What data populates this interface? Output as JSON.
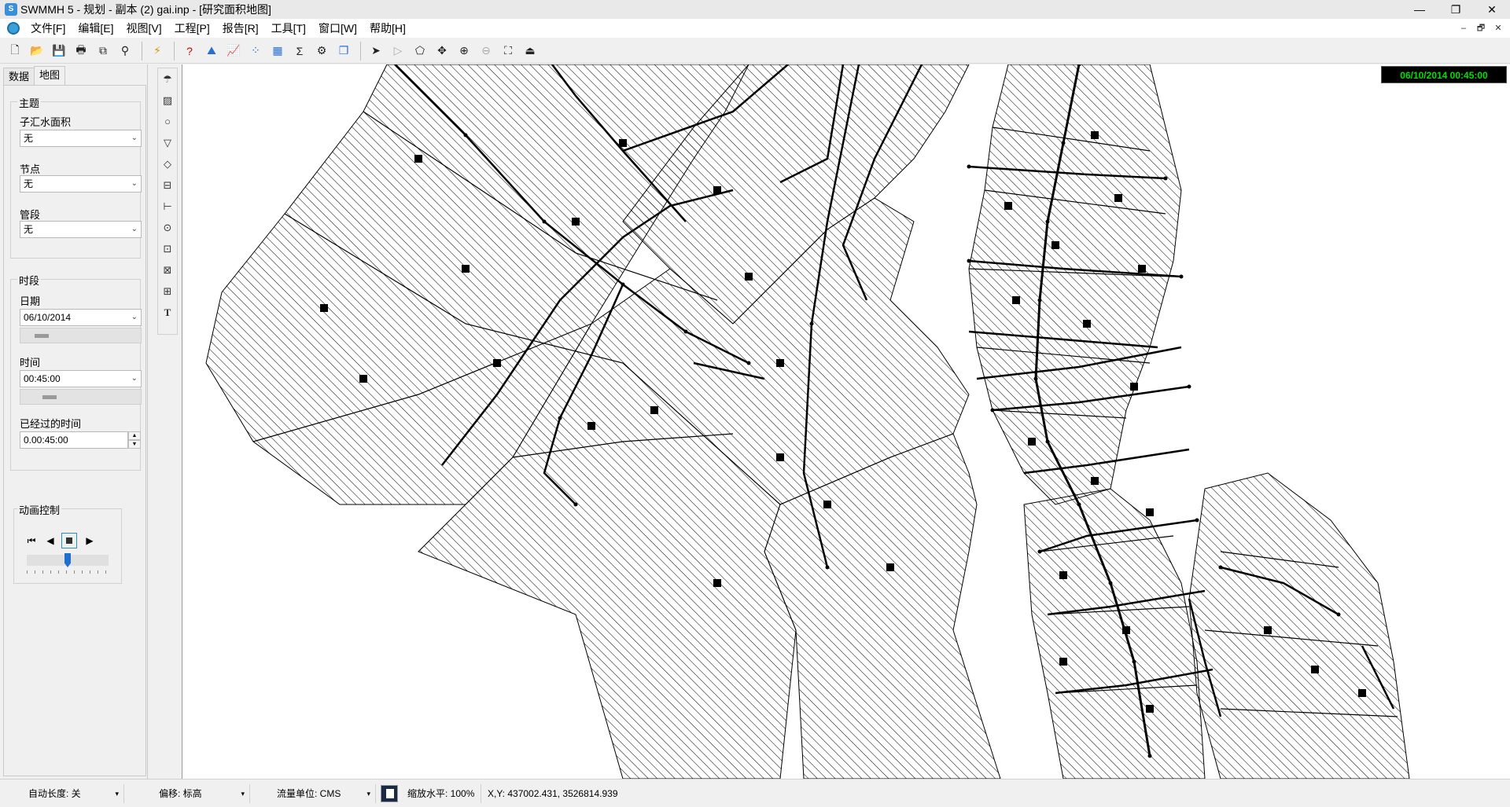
{
  "window": {
    "title": "SWMMH 5 - 规划 - 副本 (2) gai.inp - [研究面积地图]",
    "controls": [
      "—",
      "❐",
      "✕"
    ]
  },
  "menu": {
    "items": [
      "文件[F]",
      "编辑[E]",
      "视图[V]",
      "工程[P]",
      "报告[R]",
      "工具[T]",
      "窗口[W]",
      "帮助[H]"
    ],
    "mdi_controls": [
      "–",
      "🗗",
      "✕"
    ]
  },
  "toolbar": {
    "file_icons": [
      "new-file-icon",
      "open-folder-icon",
      "save-icon",
      "print-icon",
      "copy-icon",
      "find-icon"
    ],
    "run_icon": "run-lightning-icon",
    "view_icons": [
      "query-icon",
      "profile-plot-icon",
      "time-series-icon",
      "scatter-plot-icon",
      "table-icon",
      "statistics-icon",
      "options-icon",
      "arrange-windows-icon"
    ],
    "map_icons": [
      "select-object-icon",
      "select-vertex-icon",
      "select-region-icon",
      "pan-icon",
      "zoom-in-icon",
      "zoom-out-icon",
      "full-extent-icon",
      "measure-icon"
    ]
  },
  "left_panel": {
    "tabs": [
      "数据",
      "地图"
    ],
    "active_tab": "地图",
    "theme": {
      "title": "主题",
      "subcatchment_label": "子汇水面积",
      "subcatchment_value": "无",
      "node_label": "节点",
      "node_value": "无",
      "link_label": "管段",
      "link_value": "无"
    },
    "period": {
      "title": "时段",
      "date_label": "日期",
      "date_value": "06/10/2014",
      "time_label": "时间",
      "time_value": "00:45:00",
      "elapsed_label": "已经过的时间",
      "elapsed_value": "0.00:45:00"
    },
    "animation": {
      "title": "动画控制",
      "speed": 0.5
    }
  },
  "draw_toolbar": [
    "rain-gage-icon",
    "subcatchment-icon",
    "junction-icon",
    "outfall-icon",
    "divider-icon",
    "storage-icon",
    "conduit-icon",
    "pump-icon",
    "orifice-icon",
    "weir-icon",
    "outlet-icon",
    "label-text-icon"
  ],
  "map": {
    "timestamp": "06/10/2014 00:45:00",
    "background": "#ffffff",
    "line_color": "#000000"
  },
  "status": {
    "auto_length": "自动长度: 关",
    "offsets": "偏移: 标高",
    "flow_units": "流量单位: CMS",
    "zoom": "缩放水平: 100%",
    "xy": "X,Y: 437002.431, 3526814.939"
  }
}
